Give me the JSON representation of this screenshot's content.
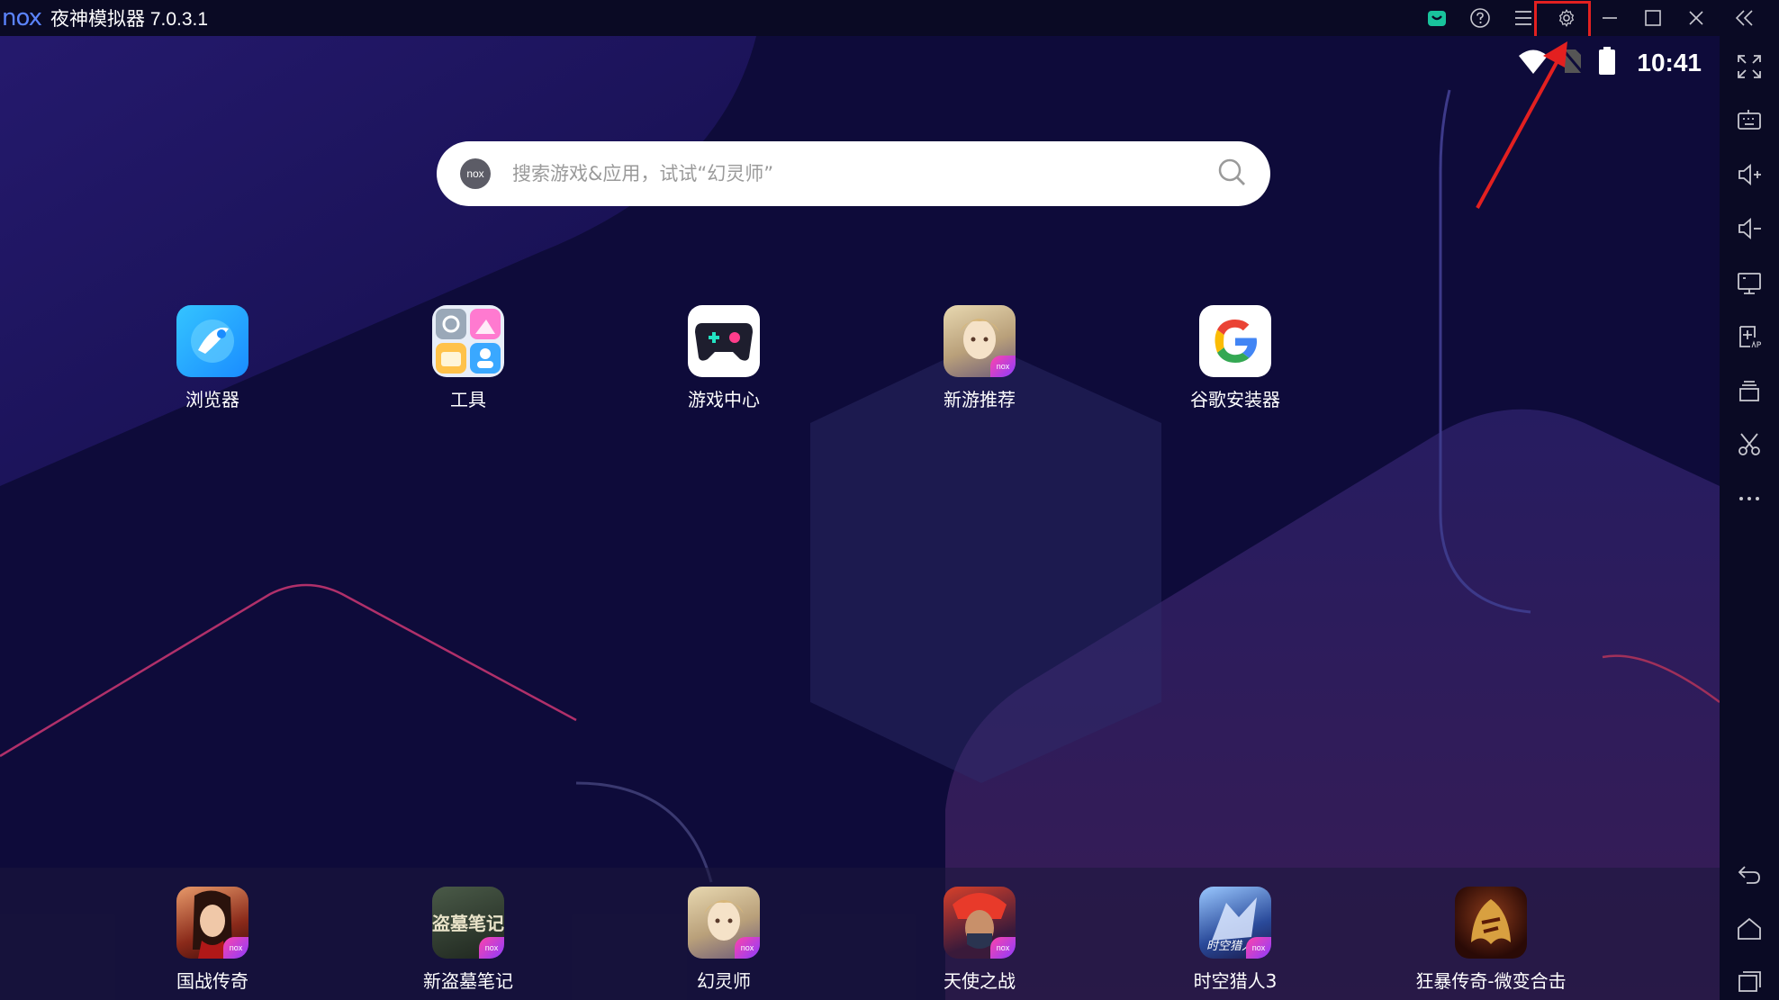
{
  "titlebar": {
    "logo": "nox",
    "title": "夜神模拟器 7.0.3.1",
    "icons": [
      "shop-icon",
      "help-icon",
      "menu-icon",
      "settings-icon",
      "minimize-icon",
      "maximize-icon",
      "close-icon",
      "collapse-sidebar-icon"
    ]
  },
  "status": {
    "time": "10:41",
    "icons": [
      "wifi-icon",
      "no-sim-icon",
      "battery-icon"
    ]
  },
  "search": {
    "logo": "nox",
    "placeholder": "搜索游戏&应用，试试“幻灵师”"
  },
  "apps": [
    {
      "label": "浏览器",
      "icon": "browser-icon"
    },
    {
      "label": "工具",
      "icon": "tools-icon"
    },
    {
      "label": "游戏中心",
      "icon": "game-center-icon"
    },
    {
      "label": "新游推荐",
      "icon": "new-games-icon"
    },
    {
      "label": "谷歌安装器",
      "icon": "google-installer-icon"
    }
  ],
  "dock": [
    {
      "label": "国战传奇",
      "icon": "guozhan-chuanqi-icon"
    },
    {
      "label": "新盗墓笔记",
      "icon": "daomu-biji-icon",
      "art_text": "盗墓笔记"
    },
    {
      "label": "幻灵师",
      "icon": "huanlingshi-icon"
    },
    {
      "label": "天使之战",
      "icon": "tianshi-zhizhan-icon"
    },
    {
      "label": "时空猎人3",
      "icon": "shikong-lieren-icon",
      "art_text": "时空猎人"
    },
    {
      "label": "狂暴传奇-微变合击",
      "icon": "kuangbao-chuanqi-icon"
    }
  ],
  "badge": "nox",
  "sidebar": {
    "icons": [
      "fullscreen-icon",
      "keyboard-icon",
      "volume-up-icon",
      "volume-down-icon",
      "screen-icon",
      "apk-install-icon",
      "multi-instance-icon",
      "screenshot-scissors-icon",
      "more-icon",
      "back-icon",
      "home-icon",
      "recent-apps-icon"
    ]
  },
  "colors": {
    "accent": "#5b84ff",
    "highlight": "#e32020",
    "background": "#0e0b3a"
  }
}
